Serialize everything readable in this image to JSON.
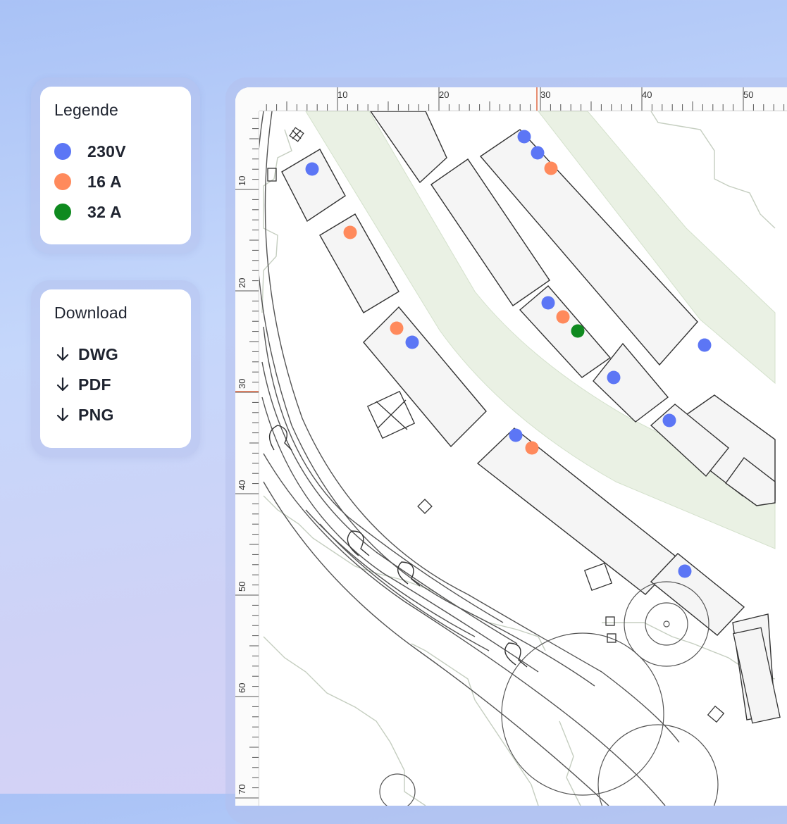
{
  "colors": {
    "v230": "#5c76f5",
    "a16": "#ff8a5c",
    "a32": "#0f8a1f",
    "ruler_marker": "#e06a44"
  },
  "legend": {
    "title": "Legende",
    "items": [
      {
        "label": "230V",
        "color": "#5c76f5"
      },
      {
        "label": "16 A",
        "color": "#ff8a5c"
      },
      {
        "label": "32 A",
        "color": "#0f8a1f"
      }
    ]
  },
  "download": {
    "title": "Download",
    "icon": "arrow-down-icon",
    "items": [
      {
        "label": "DWG"
      },
      {
        "label": "PDF"
      },
      {
        "label": "PNG"
      }
    ]
  },
  "ruler": {
    "x_labels": [
      "10",
      "20",
      "30",
      "40",
      "50"
    ],
    "y_labels": [
      "10",
      "20",
      "30",
      "40",
      "50",
      "60",
      "70"
    ],
    "x_marker": "30",
    "y_marker": "30"
  },
  "markers": [
    {
      "type": "230V"
    },
    {
      "type": "230V"
    },
    {
      "type": "16 A"
    },
    {
      "type": "230V"
    },
    {
      "type": "16 A"
    },
    {
      "type": "16 A"
    },
    {
      "type": "230V"
    },
    {
      "type": "230V"
    },
    {
      "type": "16 A"
    },
    {
      "type": "32 A"
    },
    {
      "type": "230V"
    },
    {
      "type": "230V"
    },
    {
      "type": "230V"
    },
    {
      "type": "230V"
    },
    {
      "type": "16 A"
    },
    {
      "type": "230V"
    }
  ]
}
